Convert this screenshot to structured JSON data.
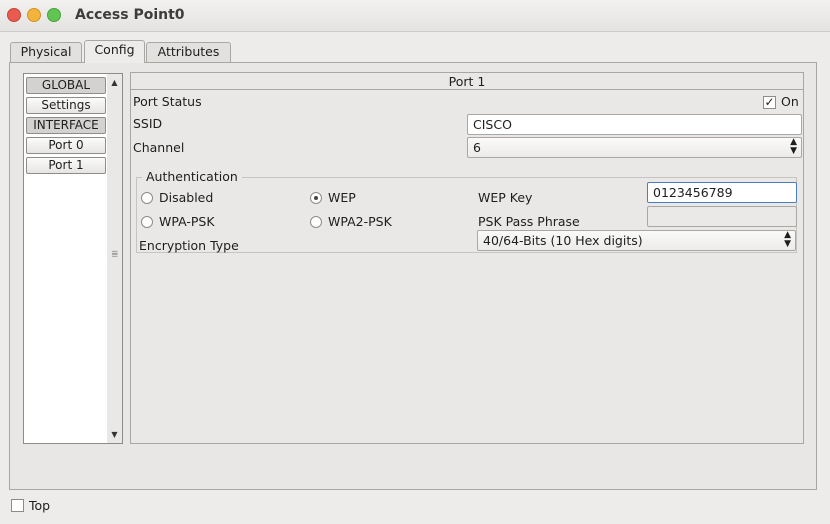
{
  "window": {
    "title": "Access Point0"
  },
  "tabs": [
    {
      "label": "Physical",
      "active": false
    },
    {
      "label": "Config",
      "active": true
    },
    {
      "label": "Attributes",
      "active": false
    }
  ],
  "nav": {
    "items": [
      {
        "label": "GLOBAL",
        "kind": "header"
      },
      {
        "label": "Settings",
        "kind": "button"
      },
      {
        "label": "INTERFACE",
        "kind": "header"
      },
      {
        "label": "Port 0",
        "kind": "button"
      },
      {
        "label": "Port 1",
        "kind": "button"
      }
    ]
  },
  "port": {
    "title": "Port 1",
    "status_label": "Port Status",
    "status_on_label": "On",
    "status_on": true,
    "ssid_label": "SSID",
    "ssid_value": "CISCO",
    "channel_label": "Channel",
    "channel_value": "6",
    "auth": {
      "legend": "Authentication",
      "disabled_label": "Disabled",
      "wep_label": "WEP",
      "wpapsk_label": "WPA-PSK",
      "wpa2psk_label": "WPA2-PSK",
      "selected": "WEP",
      "wep_key_label": "WEP Key",
      "wep_key_value": "0123456789",
      "psk_label": "PSK Pass Phrase",
      "psk_value": "",
      "encryption_label": "Encryption Type",
      "encryption_value": "40/64-Bits (10 Hex digits)"
    }
  },
  "footer": {
    "top_label": "Top",
    "top_checked": false
  }
}
